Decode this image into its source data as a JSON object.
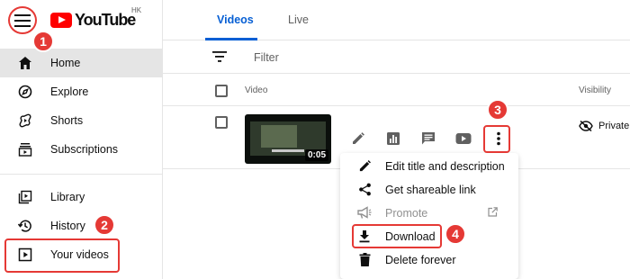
{
  "masthead": {
    "logo_text": "YouTube",
    "region": "HK"
  },
  "sidebar": {
    "items": [
      {
        "label": "Home",
        "icon": "home-icon",
        "active": true
      },
      {
        "label": "Explore",
        "icon": "compass-icon"
      },
      {
        "label": "Shorts",
        "icon": "shorts-icon"
      },
      {
        "label": "Subscriptions",
        "icon": "subscriptions-icon"
      },
      {
        "label": "Library",
        "icon": "library-icon"
      },
      {
        "label": "History",
        "icon": "history-icon"
      },
      {
        "label": "Your videos",
        "icon": "your-videos-icon"
      }
    ]
  },
  "main": {
    "tabs": [
      {
        "label": "Videos",
        "active": true
      },
      {
        "label": "Live"
      }
    ],
    "filter_placeholder": "Filter",
    "columns": {
      "video": "Video",
      "visibility": "Visibility"
    },
    "video_row": {
      "duration": "0:05",
      "visibility": "Private",
      "actions": [
        "pencil-icon",
        "analytics-icon",
        "comments-icon",
        "youtube-icon",
        "more-vert-icon"
      ]
    }
  },
  "options_menu": {
    "items": [
      {
        "label": "Edit title and description",
        "icon": "pencil-icon"
      },
      {
        "label": "Get shareable link",
        "icon": "share-icon"
      },
      {
        "label": "Promote",
        "icon": "megaphone-icon",
        "disabled": true,
        "trailing_icon": "external-link-icon"
      },
      {
        "label": "Download",
        "icon": "download-icon"
      },
      {
        "label": "Delete forever",
        "icon": "trash-icon"
      }
    ]
  },
  "annotations": {
    "steps": [
      "1",
      "2",
      "3",
      "4"
    ],
    "color": "#e53935"
  },
  "colors": {
    "accent": "#065fd4",
    "brand": "#ff0000",
    "active_bg": "#e5e5e5"
  }
}
